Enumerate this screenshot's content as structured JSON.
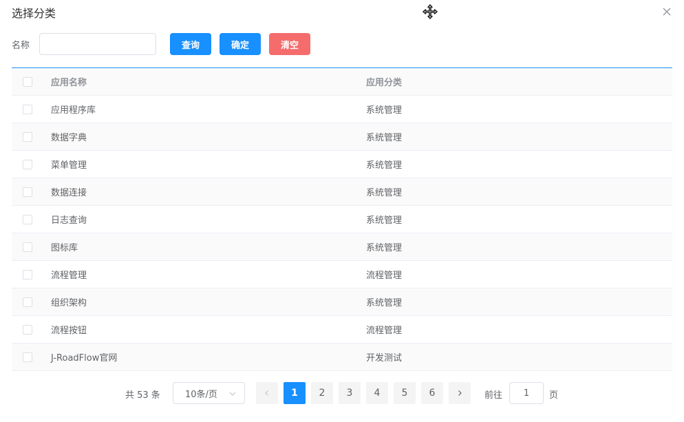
{
  "dialog": {
    "title": "选择分类",
    "icons": {
      "move": "move-icon",
      "close": "close-icon"
    }
  },
  "filter": {
    "label": "名称",
    "input_value": "",
    "input_placeholder": "",
    "query_label": "查询",
    "confirm_label": "确定",
    "clear_label": "清空"
  },
  "colors": {
    "primary": "#1890ff",
    "danger": "#f56c6c"
  },
  "table": {
    "columns": [
      "应用名称",
      "应用分类"
    ],
    "rows": [
      {
        "name": "应用程序库",
        "category": "系统管理"
      },
      {
        "name": "数据字典",
        "category": "系统管理"
      },
      {
        "name": "菜单管理",
        "category": "系统管理"
      },
      {
        "name": "数据连接",
        "category": "系统管理"
      },
      {
        "name": "日志查询",
        "category": "系统管理"
      },
      {
        "name": "图标库",
        "category": "系统管理"
      },
      {
        "name": "流程管理",
        "category": "流程管理"
      },
      {
        "name": "组织架构",
        "category": "系统管理"
      },
      {
        "name": "流程按钮",
        "category": "流程管理"
      },
      {
        "name": "J-RoadFlow官网",
        "category": "开发测试"
      }
    ]
  },
  "pagination": {
    "total_text": "共 53 条",
    "page_size": "10条/页",
    "pages": [
      "1",
      "2",
      "3",
      "4",
      "5",
      "6"
    ],
    "current_page": "1",
    "prev_icon": "chevron-left-icon",
    "next_icon": "chevron-right-icon",
    "goto_label": "前往",
    "goto_value": "1",
    "page_suffix": "页"
  }
}
